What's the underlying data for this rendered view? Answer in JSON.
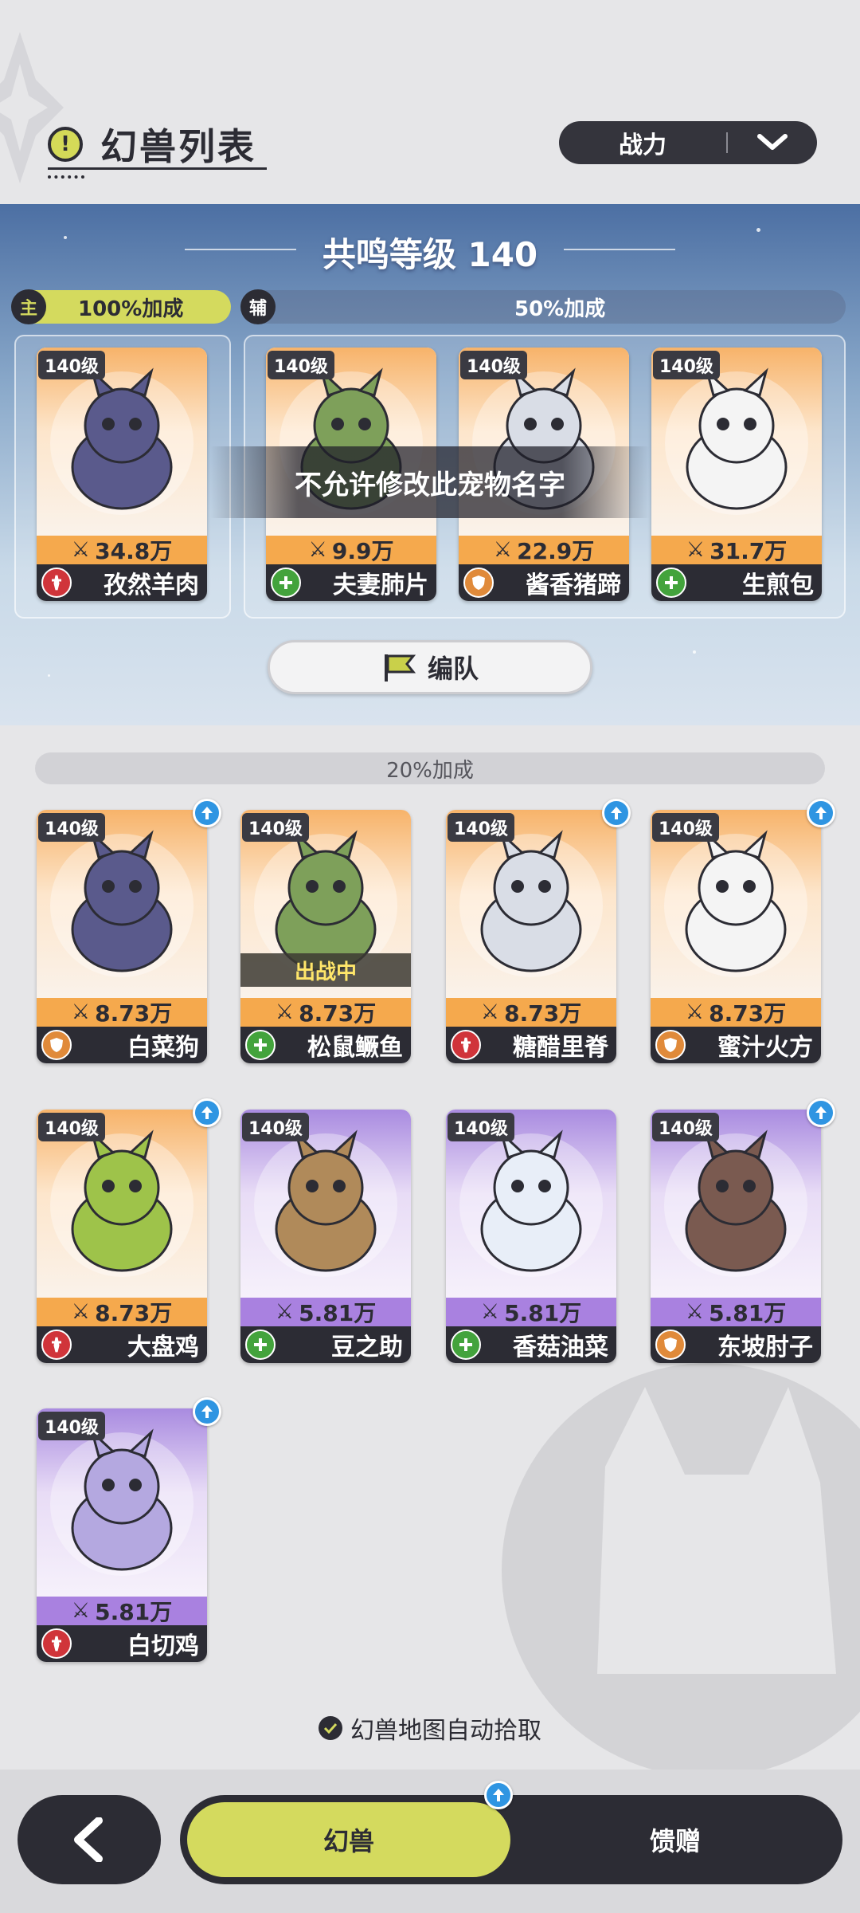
{
  "header": {
    "title": "幻兽列表",
    "sort_label": "战力"
  },
  "resonance": {
    "title": "共鸣等级 140",
    "main_tag": "主",
    "main_bonus": "100%加成",
    "sub_tag": "辅",
    "sub_bonus": "50%加成",
    "toast": "不允许修改此宠物名字",
    "team_button": "编队"
  },
  "team": [
    {
      "level": "140级",
      "power": "34.8万",
      "name": "孜然羊肉",
      "role": "attack",
      "rarity": "orange"
    },
    {
      "level": "140级",
      "power": "9.9万",
      "name": "夫妻肺片",
      "role": "heal",
      "rarity": "orange"
    },
    {
      "level": "140级",
      "power": "22.9万",
      "name": "酱香猪蹄",
      "role": "defense",
      "rarity": "orange"
    },
    {
      "level": "140级",
      "power": "31.7万",
      "name": "生煎包",
      "role": "heal",
      "rarity": "orange"
    }
  ],
  "list_bonus": "20%加成",
  "pets": [
    {
      "level": "140级",
      "power": "8.73万",
      "name": "白菜狗",
      "role": "defense",
      "rarity": "orange",
      "upgrade": true
    },
    {
      "level": "140级",
      "power": "8.73万",
      "name": "松鼠鳜鱼",
      "role": "heal",
      "rarity": "orange",
      "upgrade": false,
      "status": "出战中"
    },
    {
      "level": "140级",
      "power": "8.73万",
      "name": "糖醋里脊",
      "role": "attack",
      "rarity": "orange",
      "upgrade": true
    },
    {
      "level": "140级",
      "power": "8.73万",
      "name": "蜜汁火方",
      "role": "defense",
      "rarity": "orange",
      "upgrade": true
    },
    {
      "level": "140级",
      "power": "8.73万",
      "name": "大盘鸡",
      "role": "attack",
      "rarity": "orange",
      "upgrade": true
    },
    {
      "level": "140级",
      "power": "5.81万",
      "name": "豆之助",
      "role": "heal",
      "rarity": "purple",
      "upgrade": false
    },
    {
      "level": "140级",
      "power": "5.81万",
      "name": "香菇油菜",
      "role": "heal",
      "rarity": "purple",
      "upgrade": false
    },
    {
      "level": "140级",
      "power": "5.81万",
      "name": "东坡肘子",
      "role": "defense",
      "rarity": "purple",
      "upgrade": true
    },
    {
      "level": "140级",
      "power": "5.81万",
      "name": "白切鸡",
      "role": "attack",
      "rarity": "purple",
      "upgrade": true
    }
  ],
  "auto_pickup": "幻兽地图自动拾取",
  "tabs": {
    "active": "幻兽",
    "gift": "馈赠"
  },
  "colors": {
    "accent": "#d4da5e",
    "dark": "#2c2c34",
    "orange_card": "#f5a94d",
    "purple_card": "#a981e0",
    "upgrade": "#2f95e2"
  }
}
